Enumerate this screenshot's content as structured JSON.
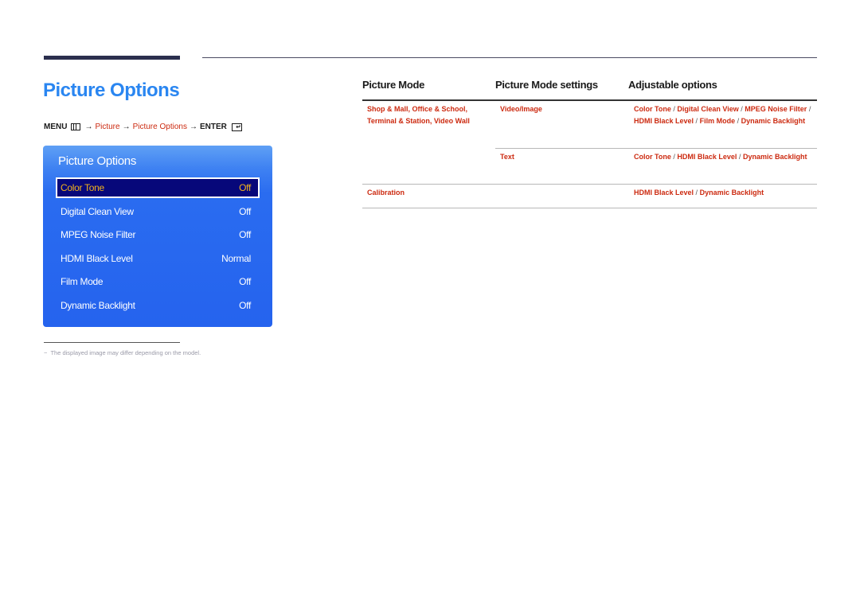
{
  "page": {
    "title": "Picture Options",
    "nav_path": {
      "menu": "MENU",
      "menu_icon": "menu-grid-icon",
      "arrow": "→",
      "step1": "Picture",
      "step2": "Picture Options",
      "enter": "ENTER",
      "enter_icon": "enter-icon"
    },
    "footnote": {
      "dash": "−",
      "text": "The displayed image may differ depending on the model."
    }
  },
  "osd": {
    "title": "Picture Options",
    "items": [
      {
        "label": "Color Tone",
        "value": "Off",
        "selected": true
      },
      {
        "label": "Digital Clean View",
        "value": "Off"
      },
      {
        "label": "MPEG Noise Filter",
        "value": "Off"
      },
      {
        "label": "HDMI Black Level",
        "value": "Normal"
      },
      {
        "label": "Film Mode",
        "value": "Off"
      },
      {
        "label": "Dynamic Backlight",
        "value": "Off"
      }
    ],
    "colors": {
      "panel": "#2563ee",
      "selected_bg": "#07087a",
      "selected_text": "#f2b21d"
    }
  },
  "table": {
    "headers": [
      "Picture Mode",
      "Picture Mode settings",
      "Adjustable options"
    ],
    "rows": [
      {
        "mode_line1": "Shop & Mall, Office & School,",
        "mode_line2": "Terminal & Station, Video Wall",
        "setting": "Video/Image",
        "options": [
          "Color Tone",
          "Digital Clean View",
          "MPEG Noise Filter",
          "HDMI Black Level",
          "Film Mode",
          "Dynamic Backlight"
        ]
      },
      {
        "mode_line1": "",
        "mode_line2": "",
        "setting": "Text",
        "options": [
          "Color Tone",
          "HDMI Black Level",
          "Dynamic Backlight"
        ]
      },
      {
        "mode_line1": "Calibration",
        "mode_line2": "",
        "setting": "",
        "options": [
          "HDMI Black Level",
          "Dynamic Backlight"
        ]
      }
    ],
    "separator": "/",
    "colors": {
      "link": "#cc2a10",
      "heading": "#1a1a1a"
    }
  }
}
